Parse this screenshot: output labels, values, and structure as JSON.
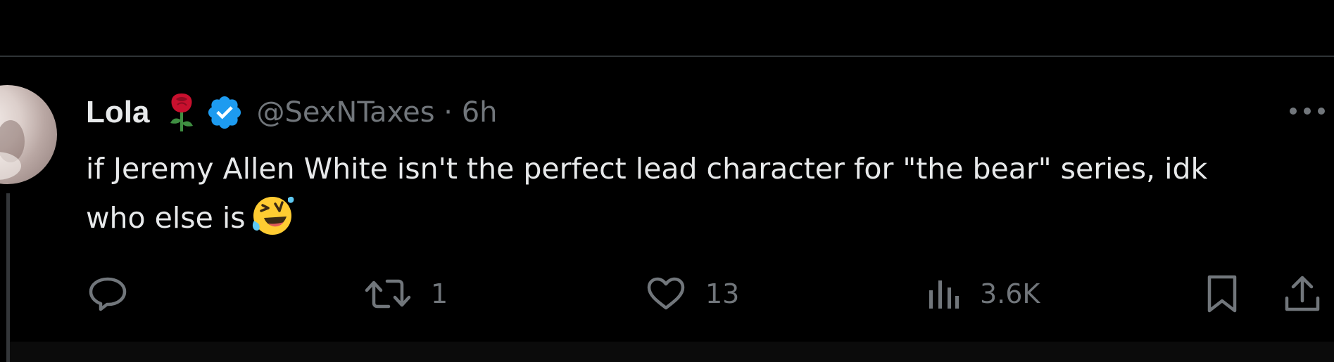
{
  "tweet": {
    "author": {
      "display_name": "Lola",
      "name_emoji": "rose-icon",
      "verified_badge": "verified-badge-icon",
      "handle": "@SexNTaxes",
      "separator": " · ",
      "time": "6h"
    },
    "text": {
      "line1": "if Jeremy Allen White isn't the perfect lead character for \"the bear\" series, idk",
      "line2": "who else is",
      "emoji": "rolling-on-floor-laughing-icon"
    },
    "actions": {
      "reply": {
        "icon": "reply-icon",
        "count": ""
      },
      "retweet": {
        "icon": "retweet-icon",
        "count": "1"
      },
      "like": {
        "icon": "heart-icon",
        "count": "13"
      },
      "views": {
        "icon": "views-icon",
        "count": "3.6K"
      },
      "bookmark": {
        "icon": "bookmark-icon"
      },
      "share": {
        "icon": "share-icon"
      }
    },
    "more_menu": {
      "icon": "more-icon"
    }
  },
  "colors": {
    "background": "#000000",
    "primary_text": "#e7e9ea",
    "secondary_text": "#71767b",
    "divider": "#2f3336",
    "verified_blue": "#1d9bf0"
  }
}
